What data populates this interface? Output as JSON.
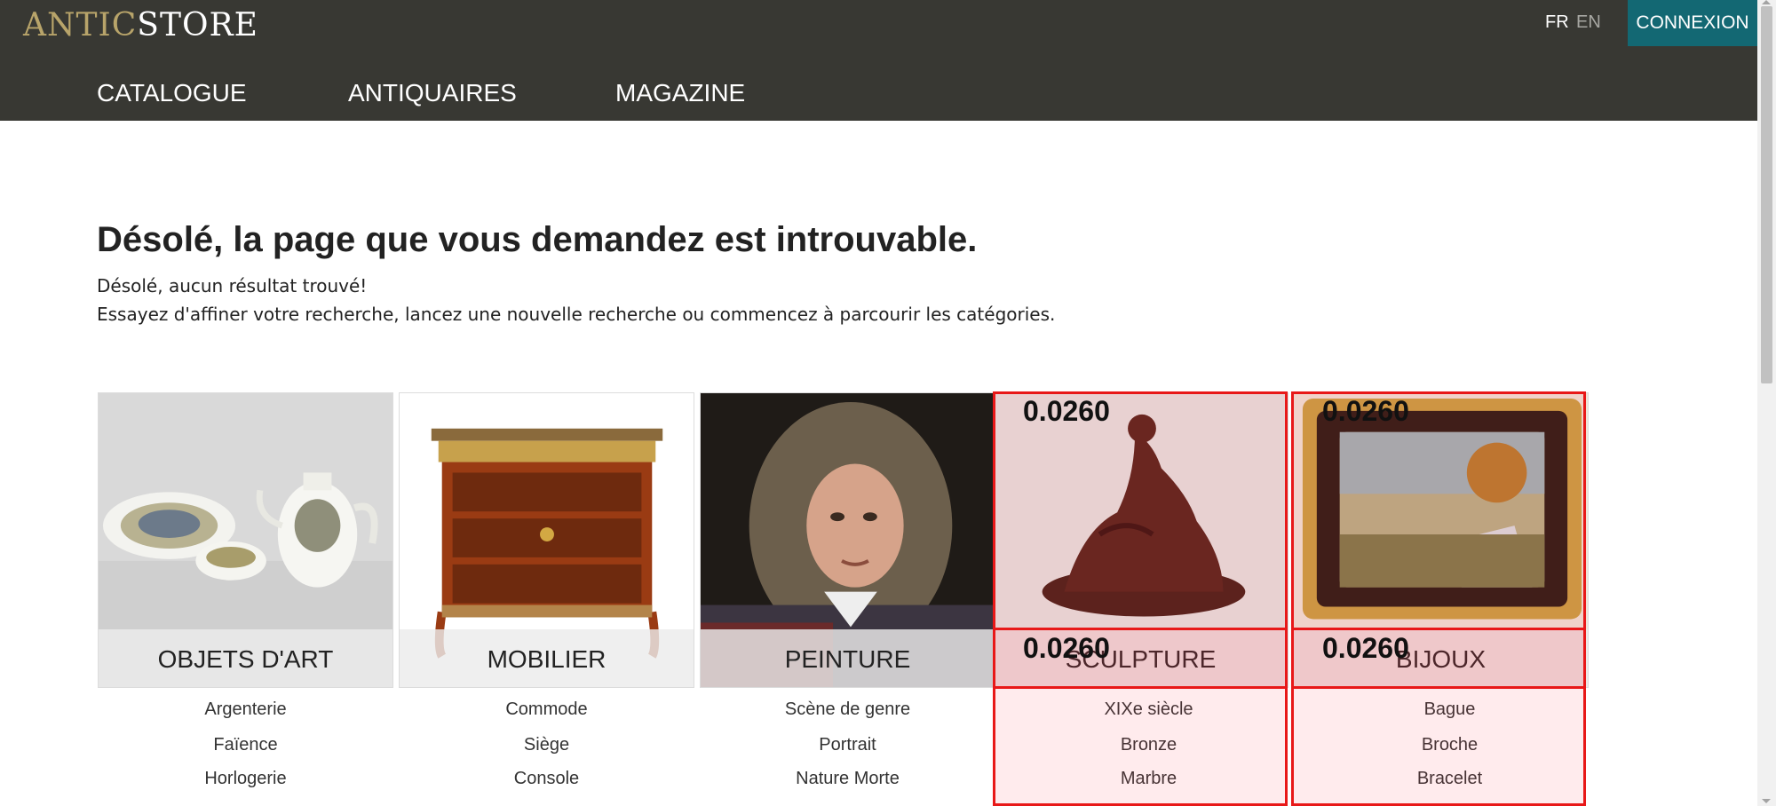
{
  "header": {
    "logo_part1": "ANTIC",
    "logo_part2": "STORE",
    "lang_fr": "FR",
    "lang_en": "EN",
    "login_label": "CONNEXION",
    "nav": [
      {
        "label": "CATALOGUE"
      },
      {
        "label": "ANTIQUAIRES"
      },
      {
        "label": "MAGAZINE"
      }
    ]
  },
  "main": {
    "title": "Désolé, la page que vous demandez est introuvable.",
    "message1": "Désolé, aucun résultat trouvé!",
    "message2": "Essayez d'affiner votre recherche, lancez une nouvelle recherche ou commencez à parcourir les catégories."
  },
  "categories": [
    {
      "label": "OBJETS D'ART",
      "sub": [
        "Argenterie",
        "Faïence",
        "Horlogerie"
      ]
    },
    {
      "label": "MOBILIER",
      "sub": [
        "Commode",
        "Siège",
        "Console"
      ]
    },
    {
      "label": "PEINTURE",
      "sub": [
        "Scène de genre",
        "Portrait",
        "Nature Morte"
      ]
    },
    {
      "label": "SCULPTURE",
      "sub": [
        "XIXe siècle",
        "Bronze",
        "Marbre"
      ]
    },
    {
      "label": "BIJOUX",
      "sub": [
        "Bague",
        "Broche",
        "Bracelet"
      ]
    }
  ],
  "overlays": {
    "score_label": "0.0260"
  },
  "colors": {
    "header_bg": "#383833",
    "logo_gold": "#b8a46a",
    "login_bg": "#136873",
    "overlay_red": "#e81818"
  }
}
